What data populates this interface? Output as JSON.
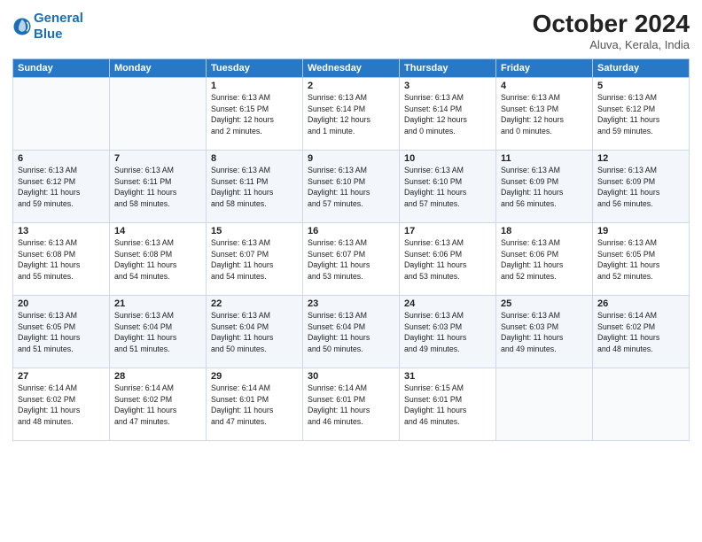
{
  "header": {
    "logo_line1": "General",
    "logo_line2": "Blue",
    "month": "October 2024",
    "location": "Aluva, Kerala, India"
  },
  "columns": [
    "Sunday",
    "Monday",
    "Tuesday",
    "Wednesday",
    "Thursday",
    "Friday",
    "Saturday"
  ],
  "weeks": [
    [
      {
        "day": "",
        "text": ""
      },
      {
        "day": "",
        "text": ""
      },
      {
        "day": "1",
        "text": "Sunrise: 6:13 AM\nSunset: 6:15 PM\nDaylight: 12 hours\nand 2 minutes."
      },
      {
        "day": "2",
        "text": "Sunrise: 6:13 AM\nSunset: 6:14 PM\nDaylight: 12 hours\nand 1 minute."
      },
      {
        "day": "3",
        "text": "Sunrise: 6:13 AM\nSunset: 6:14 PM\nDaylight: 12 hours\nand 0 minutes."
      },
      {
        "day": "4",
        "text": "Sunrise: 6:13 AM\nSunset: 6:13 PM\nDaylight: 12 hours\nand 0 minutes."
      },
      {
        "day": "5",
        "text": "Sunrise: 6:13 AM\nSunset: 6:12 PM\nDaylight: 11 hours\nand 59 minutes."
      }
    ],
    [
      {
        "day": "6",
        "text": "Sunrise: 6:13 AM\nSunset: 6:12 PM\nDaylight: 11 hours\nand 59 minutes."
      },
      {
        "day": "7",
        "text": "Sunrise: 6:13 AM\nSunset: 6:11 PM\nDaylight: 11 hours\nand 58 minutes."
      },
      {
        "day": "8",
        "text": "Sunrise: 6:13 AM\nSunset: 6:11 PM\nDaylight: 11 hours\nand 58 minutes."
      },
      {
        "day": "9",
        "text": "Sunrise: 6:13 AM\nSunset: 6:10 PM\nDaylight: 11 hours\nand 57 minutes."
      },
      {
        "day": "10",
        "text": "Sunrise: 6:13 AM\nSunset: 6:10 PM\nDaylight: 11 hours\nand 57 minutes."
      },
      {
        "day": "11",
        "text": "Sunrise: 6:13 AM\nSunset: 6:09 PM\nDaylight: 11 hours\nand 56 minutes."
      },
      {
        "day": "12",
        "text": "Sunrise: 6:13 AM\nSunset: 6:09 PM\nDaylight: 11 hours\nand 56 minutes."
      }
    ],
    [
      {
        "day": "13",
        "text": "Sunrise: 6:13 AM\nSunset: 6:08 PM\nDaylight: 11 hours\nand 55 minutes."
      },
      {
        "day": "14",
        "text": "Sunrise: 6:13 AM\nSunset: 6:08 PM\nDaylight: 11 hours\nand 54 minutes."
      },
      {
        "day": "15",
        "text": "Sunrise: 6:13 AM\nSunset: 6:07 PM\nDaylight: 11 hours\nand 54 minutes."
      },
      {
        "day": "16",
        "text": "Sunrise: 6:13 AM\nSunset: 6:07 PM\nDaylight: 11 hours\nand 53 minutes."
      },
      {
        "day": "17",
        "text": "Sunrise: 6:13 AM\nSunset: 6:06 PM\nDaylight: 11 hours\nand 53 minutes."
      },
      {
        "day": "18",
        "text": "Sunrise: 6:13 AM\nSunset: 6:06 PM\nDaylight: 11 hours\nand 52 minutes."
      },
      {
        "day": "19",
        "text": "Sunrise: 6:13 AM\nSunset: 6:05 PM\nDaylight: 11 hours\nand 52 minutes."
      }
    ],
    [
      {
        "day": "20",
        "text": "Sunrise: 6:13 AM\nSunset: 6:05 PM\nDaylight: 11 hours\nand 51 minutes."
      },
      {
        "day": "21",
        "text": "Sunrise: 6:13 AM\nSunset: 6:04 PM\nDaylight: 11 hours\nand 51 minutes."
      },
      {
        "day": "22",
        "text": "Sunrise: 6:13 AM\nSunset: 6:04 PM\nDaylight: 11 hours\nand 50 minutes."
      },
      {
        "day": "23",
        "text": "Sunrise: 6:13 AM\nSunset: 6:04 PM\nDaylight: 11 hours\nand 50 minutes."
      },
      {
        "day": "24",
        "text": "Sunrise: 6:13 AM\nSunset: 6:03 PM\nDaylight: 11 hours\nand 49 minutes."
      },
      {
        "day": "25",
        "text": "Sunrise: 6:13 AM\nSunset: 6:03 PM\nDaylight: 11 hours\nand 49 minutes."
      },
      {
        "day": "26",
        "text": "Sunrise: 6:14 AM\nSunset: 6:02 PM\nDaylight: 11 hours\nand 48 minutes."
      }
    ],
    [
      {
        "day": "27",
        "text": "Sunrise: 6:14 AM\nSunset: 6:02 PM\nDaylight: 11 hours\nand 48 minutes."
      },
      {
        "day": "28",
        "text": "Sunrise: 6:14 AM\nSunset: 6:02 PM\nDaylight: 11 hours\nand 47 minutes."
      },
      {
        "day": "29",
        "text": "Sunrise: 6:14 AM\nSunset: 6:01 PM\nDaylight: 11 hours\nand 47 minutes."
      },
      {
        "day": "30",
        "text": "Sunrise: 6:14 AM\nSunset: 6:01 PM\nDaylight: 11 hours\nand 46 minutes."
      },
      {
        "day": "31",
        "text": "Sunrise: 6:15 AM\nSunset: 6:01 PM\nDaylight: 11 hours\nand 46 minutes."
      },
      {
        "day": "",
        "text": ""
      },
      {
        "day": "",
        "text": ""
      }
    ]
  ]
}
